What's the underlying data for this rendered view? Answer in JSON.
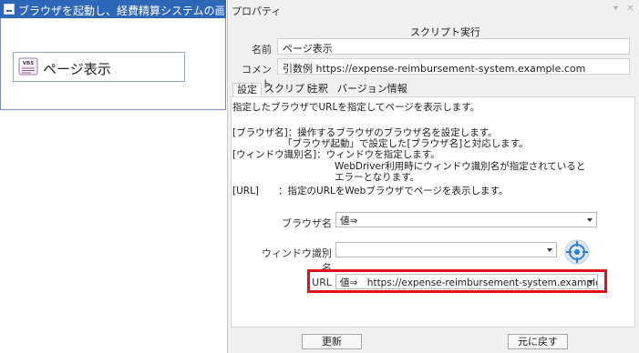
{
  "workflow": {
    "title": "ブラウザを起動し、経費精算システムの画面を開く",
    "step_label": "ページ表示",
    "step_icon_text": "VBS"
  },
  "properties": {
    "title": "プロパティ",
    "window_controls": "▾ ✕",
    "section_title": "スクリプト実行",
    "name_label": "名前",
    "name_value": "ページ表示",
    "comment_label": "コメント",
    "comment_value": "引数例 https://expense-reimbursement-system.example.com",
    "tabs": [
      {
        "label": "設定",
        "active": true
      },
      {
        "label": "スクリプト",
        "active": false
      },
      {
        "label": "注釈",
        "active": false
      },
      {
        "label": "バージョン情報",
        "active": false
      }
    ],
    "description": [
      "指定したブラウザでURLを指定してページを表示します。",
      "[ブラウザ名]：操作するブラウザのブラウザ名を設定します。",
      "「ブラウザ起動」で設定した[ブラウザ名]と対応します。",
      "[ウィンドウ識別名]：ウィンドウを指定します。",
      "WebDriver利用時にウィンドウ識別名が指定されていると",
      "エラーとなります。",
      "[URL]　　：指定のURLをWebブラウザでページを表示します。"
    ],
    "fields": {
      "browser_label": "ブラウザ名",
      "browser_value": "値⇒",
      "window_label": "ウィンドウ識別名",
      "window_value": "",
      "url_label": "URL",
      "url_value": "値⇒　https://expense-reimbursement-system.example.com"
    },
    "buttons": {
      "update": "更新",
      "revert": "元に戻す"
    },
    "highlight_color": "#e0131b",
    "accent_color": "#2e66b8"
  }
}
